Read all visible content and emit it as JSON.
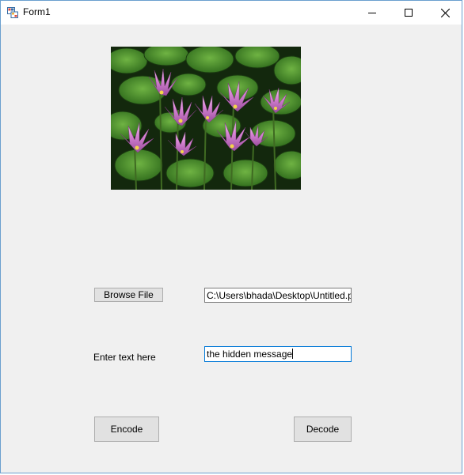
{
  "window": {
    "title": "Form1",
    "app_icon": "winforms-app-icon",
    "controls": {
      "minimize": "minimize-icon",
      "maximize": "maximize-icon",
      "close": "close-icon"
    }
  },
  "image": {
    "subject": "pink water lilies among green lily pads",
    "icon": "photo-preview"
  },
  "browse": {
    "button_label": "Browse File",
    "path_value": "C:\\Users\\bhada\\Desktop\\Untitled.png"
  },
  "message": {
    "label": "Enter text here",
    "value": "the hidden message"
  },
  "actions": {
    "encode_label": "Encode",
    "decode_label": "Decode"
  },
  "colors": {
    "window_bg": "#f0f0f0",
    "titlebar_bg": "#ffffff",
    "button_bg": "#e1e1e1",
    "focus_border": "#0078d7"
  }
}
